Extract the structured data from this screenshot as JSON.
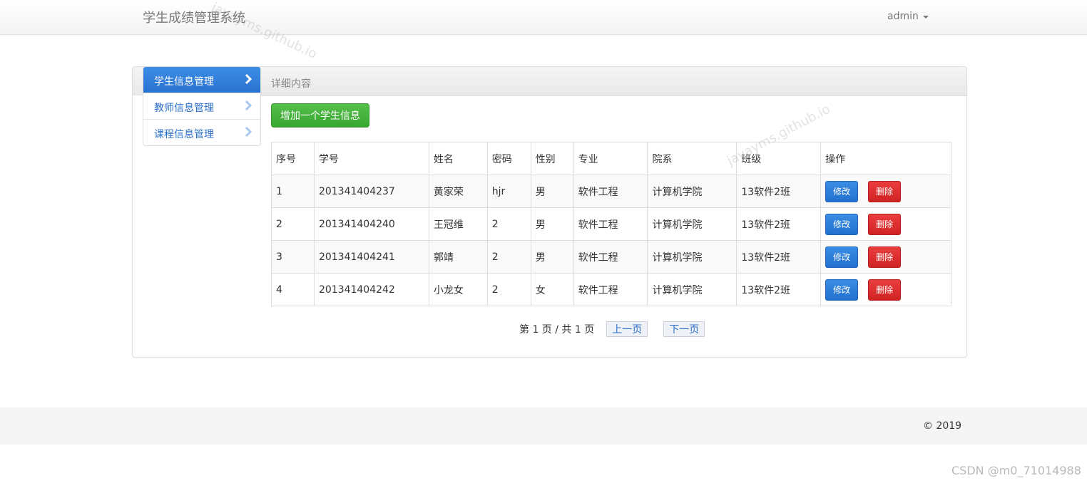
{
  "navbar": {
    "brand": "学生成绩管理系统",
    "user": "admin"
  },
  "sidebar": {
    "items": [
      {
        "label": "学生信息管理",
        "active": true
      },
      {
        "label": "教师信息管理",
        "active": false
      },
      {
        "label": "课程信息管理",
        "active": false
      }
    ]
  },
  "panel": {
    "title": "详细内容"
  },
  "toolbar": {
    "add_label": "增加一个学生信息"
  },
  "table": {
    "headers": [
      "序号",
      "学号",
      "姓名",
      "密码",
      "性别",
      "专业",
      "院系",
      "班级",
      "操作"
    ],
    "rows": [
      [
        "1",
        "201341404237",
        "黄家荣",
        "hjr",
        "男",
        "软件工程",
        "计算机学院",
        "13软件2班"
      ],
      [
        "2",
        "201341404240",
        "王冠维",
        "2",
        "男",
        "软件工程",
        "计算机学院",
        "13软件2班"
      ],
      [
        "3",
        "201341404241",
        "郭靖",
        "2",
        "男",
        "软件工程",
        "计算机学院",
        "13软件2班"
      ],
      [
        "4",
        "201341404242",
        "小龙女",
        "2",
        "女",
        "软件工程",
        "计算机学院",
        "13软件2班"
      ]
    ],
    "edit_label": "修改",
    "delete_label": "删除"
  },
  "pager": {
    "status": "第 1 页 / 共 1 页",
    "prev_label": "上一页",
    "next_label": "下一页"
  },
  "footer": {
    "copyright": "© 2019"
  },
  "watermarks": {
    "site": "javayms.github.io",
    "csdn": "CSDN @m0_71014988"
  },
  "colors": {
    "primary": "#2a72d0",
    "success": "#38a532",
    "danger": "#d02424"
  }
}
